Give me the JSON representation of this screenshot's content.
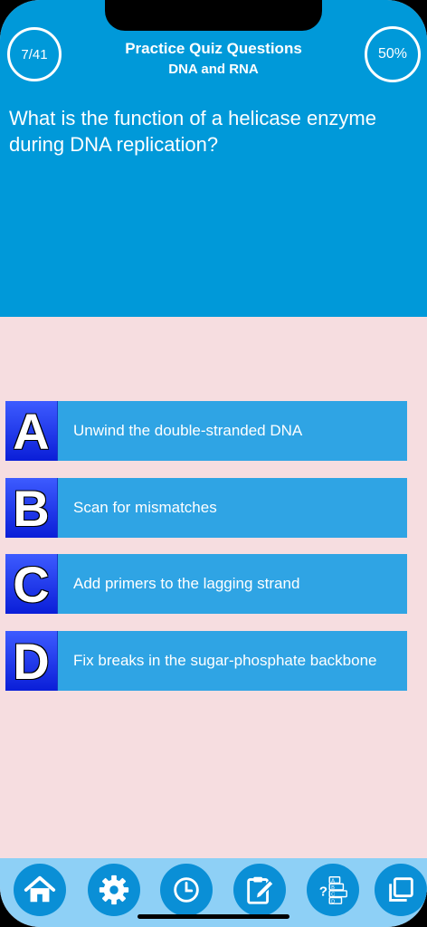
{
  "header": {
    "counter": "7/41",
    "title": "Practice Quiz Questions",
    "subtitle": "DNA and RNA",
    "percent": "50%"
  },
  "question": "What is the function of a helicase enzyme during DNA replication?",
  "answers": [
    {
      "letter": "A",
      "text": "Unwind the double-stranded DNA"
    },
    {
      "letter": "B",
      "text": "Scan for mismatches"
    },
    {
      "letter": "C",
      "text": "Add primers to the lagging strand"
    },
    {
      "letter": "D",
      "text": "Fix breaks in the sugar-phosphate backbone"
    }
  ],
  "tabbar": {
    "icons": [
      "home-icon",
      "gear-icon",
      "clock-icon",
      "edit-icon",
      "quiz-list-icon",
      "copy-icon"
    ],
    "quiz_icon_letters": [
      "?",
      "A",
      "B",
      "C",
      "D"
    ]
  },
  "colors": {
    "header_bg": "#0099d9",
    "body_bg": "#f6dde0",
    "answer_bg": "#2fa4e4",
    "letter_bg": "#1a2fe8",
    "tabbar_bg": "#8ed0f6",
    "tab_button": "#0a8fd6"
  }
}
